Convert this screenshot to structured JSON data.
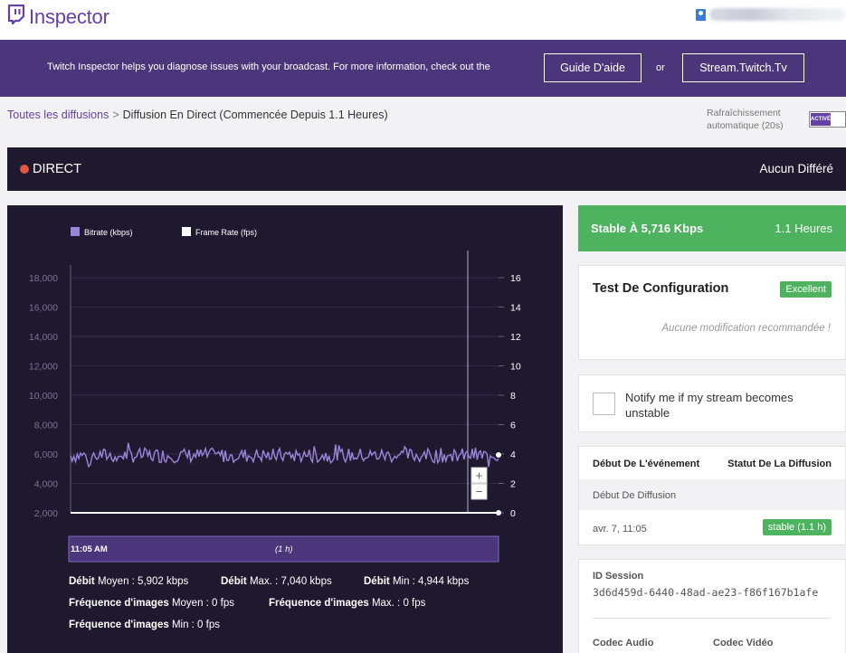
{
  "app": {
    "title": "Inspector"
  },
  "banner": {
    "text": "Twitch Inspector helps you diagnose issues with your broadcast. For more information, check out the",
    "guide_button": "Guide D'aide",
    "or_text": "or",
    "stream_button": "Stream.Twitch.Tv"
  },
  "breadcrumb": {
    "link": "Toutes les diffusions",
    "separator": ">",
    "current": "Diffusion En Direct (Commencée Depuis 1.1 Heures)"
  },
  "auto_refresh": {
    "label_line1": "Rafraîchissement",
    "label_line2": "automatique (20s)",
    "toggle_label": "ACTIVÉ",
    "enabled": true
  },
  "live": {
    "status": "DIRECT",
    "delay": "Aucun Différé"
  },
  "chart_data": {
    "type": "line",
    "legend": [
      "Bitrate (kbps)",
      "Frame Rate (fps)"
    ],
    "left_axis": {
      "ticks": [
        "18,000",
        "16,000",
        "14,000",
        "12,000",
        "10,000",
        "8,000",
        "6,000",
        "4,000",
        "2,000"
      ],
      "range": [
        0,
        18000
      ]
    },
    "right_axis": {
      "ticks": [
        "16",
        "14",
        "12",
        "10",
        "8",
        "6",
        "4",
        "2",
        "0"
      ],
      "range": [
        0,
        16
      ]
    },
    "series": [
      {
        "name": "Bitrate (kbps)",
        "color": "#9b85d9",
        "mean": 5902,
        "max": 7040,
        "min": 4944
      },
      {
        "name": "Frame Rate (fps)",
        "color": "#ffffff",
        "values": [
          0,
          0
        ]
      }
    ],
    "timeline": {
      "start": "11:05 AM",
      "duration": "(1 h)"
    },
    "zoom": {
      "plus": "+",
      "minus": "−"
    }
  },
  "stats": {
    "bitrate_avg": {
      "bold": "Débit",
      "text": " Moyen : 5,902 kbps"
    },
    "bitrate_max": {
      "bold": "Débit",
      "text": " Max. : 7,040 kbps"
    },
    "bitrate_min": {
      "bold": "Débit",
      "text": " Min : 4,944 kbps"
    },
    "fps_avg": {
      "bold": "Fréquence d'images",
      "text": " Moyen : 0 fps"
    },
    "fps_max": {
      "bold": "Fréquence d'images",
      "text": " Max. : 0 fps"
    },
    "fps_min": {
      "bold": "Fréquence d'images",
      "text": " Min : 0 fps"
    }
  },
  "stability": {
    "title": "Stable À 5,716 Kbps",
    "duration": "1.1 Heures"
  },
  "config_test": {
    "title": "Test De Configuration",
    "badge": "Excellent",
    "note": "Aucune modification recommandée !"
  },
  "notify": {
    "text": "Notify me if my stream becomes unstable",
    "checked": false
  },
  "events": {
    "col_start": "Début De L'événement",
    "col_status": "Statut De La Diffusion",
    "section": "Début De Diffusion",
    "date": "avr. 7, 11:05",
    "status": "stable (1.1 h)"
  },
  "session": {
    "label": "ID Session",
    "id": "3d6d459d-6440-48ad-ae23-f86f167b1afe",
    "codec_audio": "Codec Audio",
    "codec_video": "Codec Vidéo"
  },
  "colors": {
    "brand": "#6441a4",
    "banner": "#4b367c",
    "dark_panel": "#1f1930",
    "success": "#4db35e",
    "live": "#e05744"
  }
}
